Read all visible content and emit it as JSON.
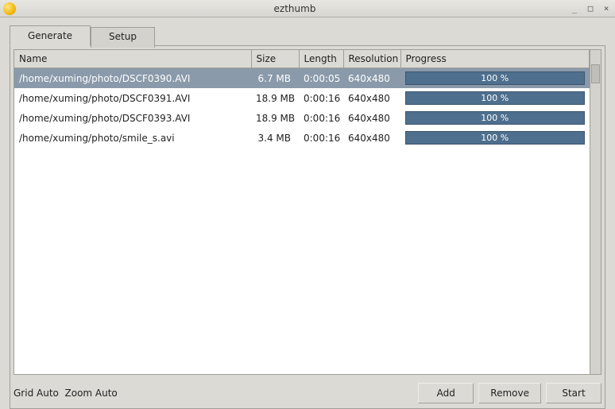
{
  "window": {
    "title": "ezthumb"
  },
  "tabs": {
    "generate": "Generate",
    "setup": "Setup"
  },
  "columns": {
    "name": "Name",
    "size": "Size",
    "length": "Length",
    "resolution": "Resolution",
    "progress": "Progress"
  },
  "rows": [
    {
      "name": "/home/xuming/photo/DSCF0390.AVI",
      "size": "6.7 MB",
      "length": "0:00:05",
      "resolution": "640x480",
      "progress": "100 %",
      "selected": true
    },
    {
      "name": "/home/xuming/photo/DSCF0391.AVI",
      "size": "18.9 MB",
      "length": "0:00:16",
      "resolution": "640x480",
      "progress": "100 %",
      "selected": false
    },
    {
      "name": "/home/xuming/photo/DSCF0393.AVI",
      "size": "18.9 MB",
      "length": "0:00:16",
      "resolution": "640x480",
      "progress": "100 %",
      "selected": false
    },
    {
      "name": "/home/xuming/photo/smile_s.avi",
      "size": "3.4 MB",
      "length": "0:00:16",
      "resolution": "640x480",
      "progress": "100 %",
      "selected": false
    }
  ],
  "status": {
    "grid": "Grid Auto",
    "zoom": "Zoom Auto"
  },
  "buttons": {
    "add": "Add",
    "remove": "Remove",
    "start": "Start"
  }
}
